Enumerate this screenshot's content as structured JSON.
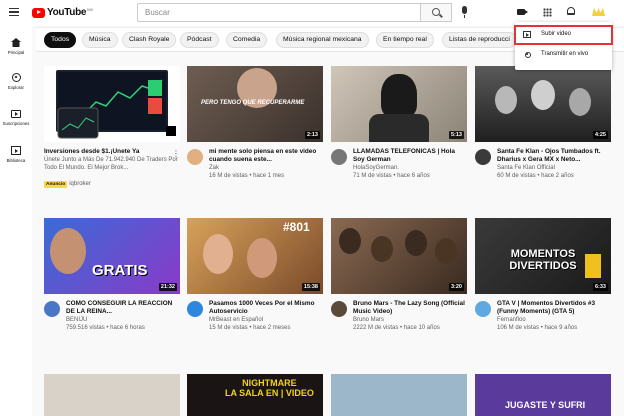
{
  "header": {
    "logo_text": "YouTube",
    "logo_country": "MX",
    "search_placeholder": "Buscar"
  },
  "chips": [
    "Todos",
    "Música",
    "Clash Royale",
    "Pódcast",
    "Comedia",
    "Música regional mexicana",
    "En tiempo real",
    "Listas de reproducci"
  ],
  "sidebar": {
    "items": [
      {
        "label": "Principal",
        "icon": "home-icon"
      },
      {
        "label": "Explorar",
        "icon": "compass-icon"
      },
      {
        "label": "Suscripciones",
        "icon": "subscriptions-icon"
      },
      {
        "label": "Biblioteca",
        "icon": "library-icon"
      }
    ]
  },
  "create_menu": {
    "items": [
      {
        "label": "Subir video",
        "icon": "upload-video-icon"
      },
      {
        "label": "Transmitir en vivo",
        "icon": "live-stream-icon"
      }
    ]
  },
  "videos": [
    {
      "type": "ad",
      "title": "Inversiones desde $1.¡Únete Ya",
      "description": "Únete Junto a Más De 71.942.940 De Traders Por Todo El Mundo. El Mejor Brok...",
      "badge": "Anuncio",
      "advertiser": "iqbroker"
    },
    {
      "title": "mi mente solo piensa en este video cuando suena este...",
      "channel": "Zak",
      "meta": "16 M de vistas • hace 1 mes",
      "duration": "2:13",
      "overlay": "PERO TENGO QUE RECUPERARME"
    },
    {
      "title": "LLAMADAS TELEFONICAS | Hola Soy German",
      "channel": "HolaSoyGerman.",
      "meta": "71 M de vistas • hace 6 años",
      "duration": "5:13"
    },
    {
      "title": "Santa Fe Klan - Ojos Tumbados ft. Dharius x Gera MX x Neto...",
      "channel": "Santa Fe Klan Official",
      "meta": "60 M de vistas • hace 2 años",
      "duration": "4:25"
    },
    {
      "title": "CÓMO CONSEGUIR LA REACCIÓN DE LA REINA...",
      "channel": "BENIJU",
      "meta": "759.516 vistas • hace 6 horas",
      "duration": "21:32",
      "overlay": "GRATIS"
    },
    {
      "title": "Pasamos 1000 Veces Por el Mismo Autoservicio",
      "channel": "MrBeast en Español",
      "meta": "15 M de vistas • hace 2 meses",
      "duration": "15:38",
      "overlay": "#801"
    },
    {
      "title": "Bruno Mars - The Lazy Song (Official Music Video)",
      "channel": "Bruno Mars",
      "meta": "2222 M de vistas • hace 10 años",
      "duration": "3:20"
    },
    {
      "title": "GTA V | Momentos Divertidos #3 (Funny Moments) (GTA 5)",
      "channel": "Fernanfloo",
      "meta": "106 M de vistas • hace 9 años",
      "duration": "6:33",
      "overlay": "MOMENTOS DIVERTIDOS"
    },
    {
      "title": "",
      "overlay": ""
    },
    {
      "title": "",
      "overlay": "NIGHTMARE\nLA SALA EN | VIDEO"
    },
    {
      "title": "",
      "overlay": ""
    },
    {
      "title": "",
      "overlay": "JUGASTE Y SUFRI"
    }
  ],
  "colors": {
    "brand_red": "#ff0000",
    "highlight_red": "#e23434",
    "ad_badge": "#f9d64d"
  }
}
